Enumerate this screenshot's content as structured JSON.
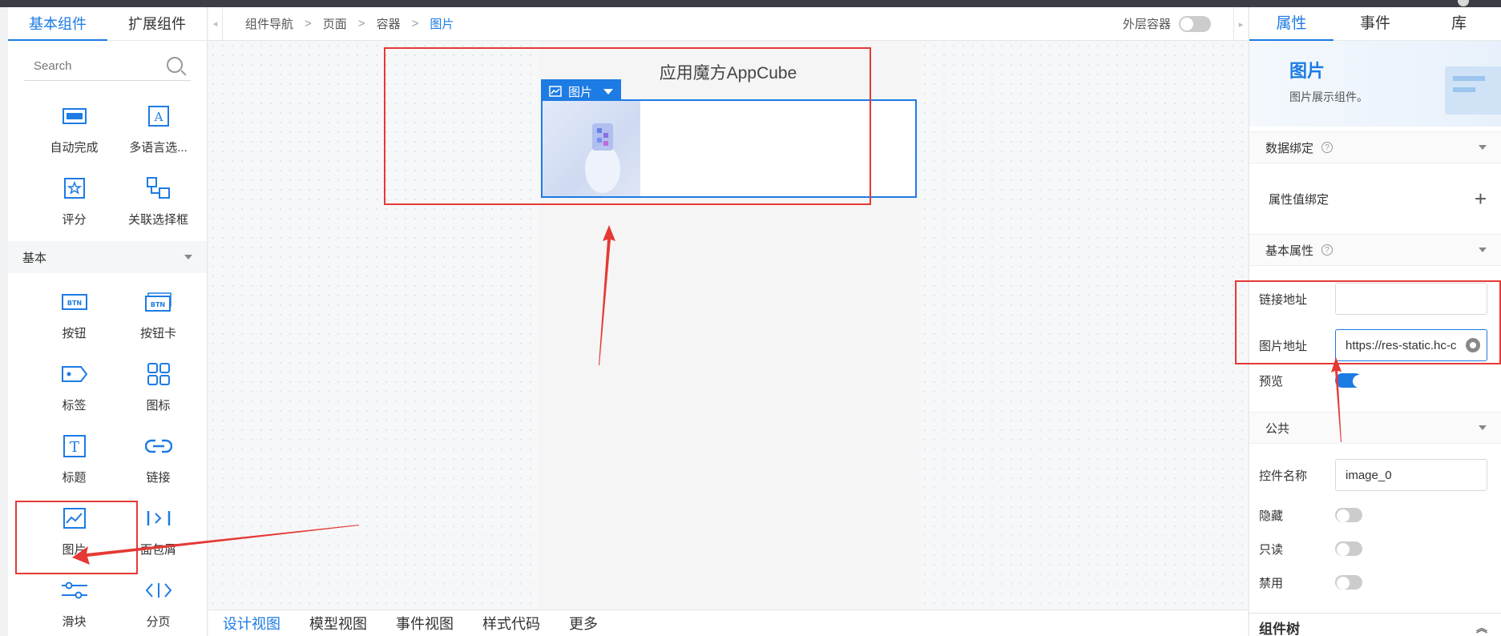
{
  "left": {
    "tabs": [
      "基本组件",
      "扩展组件"
    ],
    "search_placeholder": "Search",
    "group1": [
      {
        "label": "自动完成",
        "icon": "autocomplete-icon"
      },
      {
        "label": "多语言选...",
        "icon": "multilanguage-icon"
      },
      {
        "label": "评分",
        "icon": "rating-star-icon"
      },
      {
        "label": "关联选择框",
        "icon": "linked-select-icon"
      }
    ],
    "section_basic": "基本",
    "group2": [
      {
        "label": "按钮",
        "icon": "button-icon"
      },
      {
        "label": "按钮卡",
        "icon": "button-card-icon"
      },
      {
        "label": "标签",
        "icon": "tag-icon"
      },
      {
        "label": "图标",
        "icon": "grid-icon"
      },
      {
        "label": "标题",
        "icon": "title-icon"
      },
      {
        "label": "链接",
        "icon": "link-icon"
      },
      {
        "label": "图片",
        "icon": "image-icon"
      },
      {
        "label": "面包屑",
        "icon": "breadcrumb-icon"
      },
      {
        "label": "滑块",
        "icon": "slider-icon"
      },
      {
        "label": "分页",
        "icon": "pagination-icon"
      }
    ]
  },
  "center": {
    "breadcrumb": [
      "组件导航",
      "页面",
      "容器",
      "图片"
    ],
    "outer_container_label": "外层容器",
    "page_title": "应用魔方AppCube",
    "image_tag": "图片",
    "bottom_tabs": [
      "设计视图",
      "模型视图",
      "事件视图",
      "样式代码",
      "更多"
    ]
  },
  "right": {
    "tabs": [
      "属性",
      "事件",
      "库"
    ],
    "hero_title": "图片",
    "hero_desc": "图片展示组件。",
    "sec_data_binding": "数据绑定",
    "prop_binding_label": "属性值绑定",
    "sec_basic_props": "基本属性",
    "link_url_label": "链接地址",
    "link_url_value": "",
    "image_url_label": "图片地址",
    "image_url_value": "https://res-static.hc-c",
    "preview_label": "预览",
    "preview_on": true,
    "sec_common": "公共",
    "control_name_label": "控件名称",
    "control_name_value": "image_0",
    "hidden_label": "隐藏",
    "readonly_label": "只读",
    "disabled_label": "禁用",
    "tree_title": "组件树"
  },
  "colors": {
    "accent": "#1d7be4",
    "annotation_red": "#e53935"
  }
}
